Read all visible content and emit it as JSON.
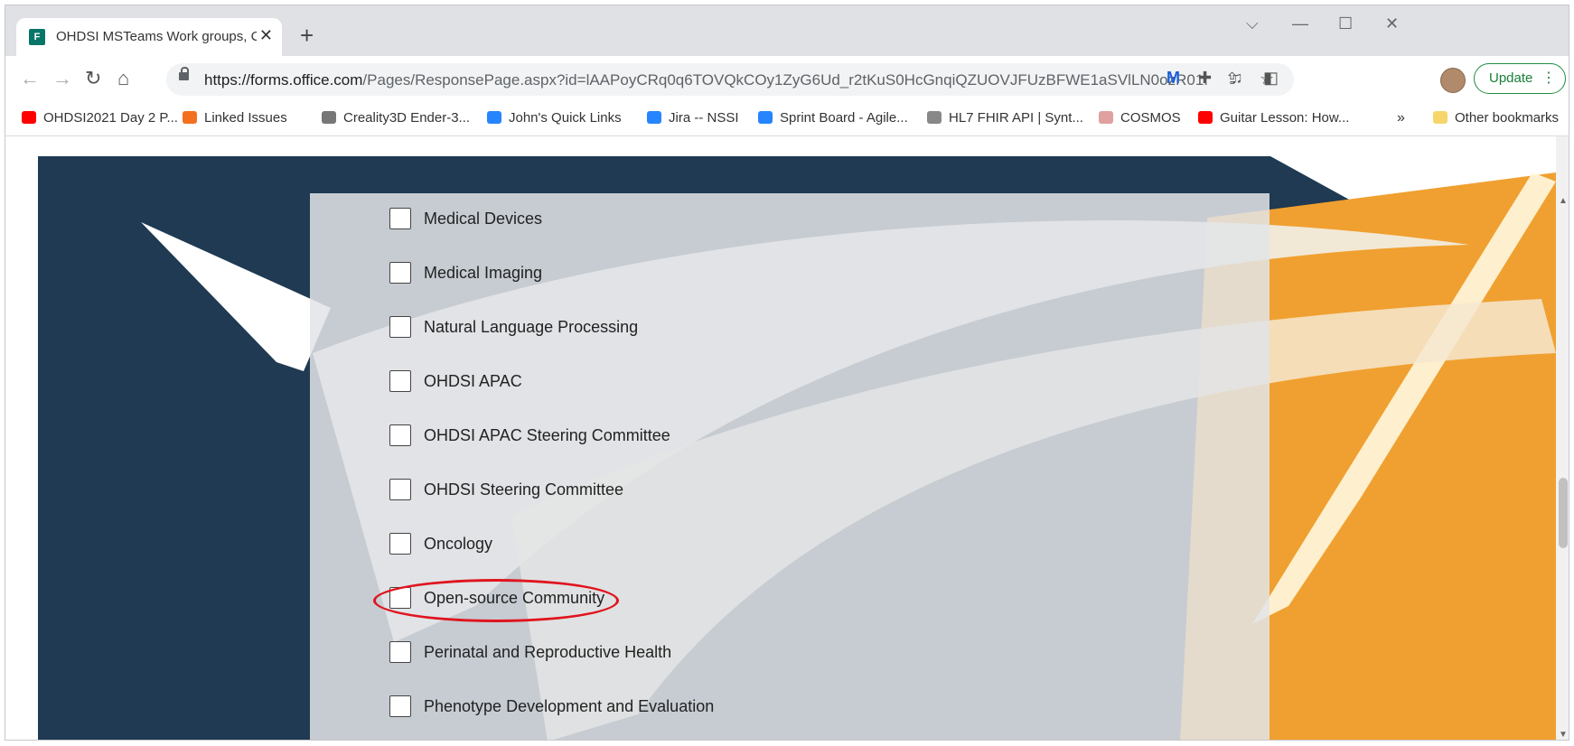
{
  "browser": {
    "tab": {
      "title": "OHDSI MSTeams Work groups, C",
      "favicon_letter": "F"
    },
    "new_tab_symbol": "+",
    "url_host": "https://forms.office.com",
    "url_path": "/Pages/ResponsePage.aspx?id=lAAPoyCRq0q6TOVQkCOy1ZyG6Ud_r2tKuS0HcGnqiQZUOVJFUzBFWE1aSVlLN0ozR01...",
    "update_label": "Update"
  },
  "bookmarks": [
    {
      "label": "OHDSI2021 Day 2 P...",
      "icon": "youtube-icon",
      "color": "#ff0000"
    },
    {
      "label": "Linked Issues",
      "icon": "people-icon",
      "color": "#f37021"
    },
    {
      "label": "Creality3D Ender-3...",
      "icon": "dash-icon",
      "color": "#777777"
    },
    {
      "label": "John's Quick Links",
      "icon": "confluence-icon",
      "color": "#2684ff"
    },
    {
      "label": "Jira -- NSSI",
      "icon": "jira-icon",
      "color": "#2684ff"
    },
    {
      "label": "Sprint Board - Agile...",
      "icon": "jira-icon",
      "color": "#2684ff"
    },
    {
      "label": "HL7 FHIR API | Synt...",
      "icon": "fingerprint-icon",
      "color": "#888888"
    },
    {
      "label": "COSMOS",
      "icon": "hello-kitty-icon",
      "color": "#e0a0a0"
    },
    {
      "label": "Guitar Lesson: How...",
      "icon": "youtube-icon",
      "color": "#ff0000"
    }
  ],
  "bookmarks_overflow": "»",
  "other_bookmarks": "Other bookmarks",
  "form": {
    "options": [
      "Medical Devices",
      "Medical Imaging",
      "Natural Language Processing",
      "OHDSI APAC",
      "OHDSI APAC Steering Committee",
      "OHDSI Steering Committee",
      "Oncology",
      "Open-source Community",
      "Perinatal and Reproductive Health",
      "Phenotype Development and Evaluation"
    ],
    "highlighted_option": "Open-source Community"
  },
  "colors": {
    "navy": "#1f3a52",
    "orange": "#f0a030",
    "highlight_ring": "#e0141e",
    "update_green": "#188038"
  }
}
